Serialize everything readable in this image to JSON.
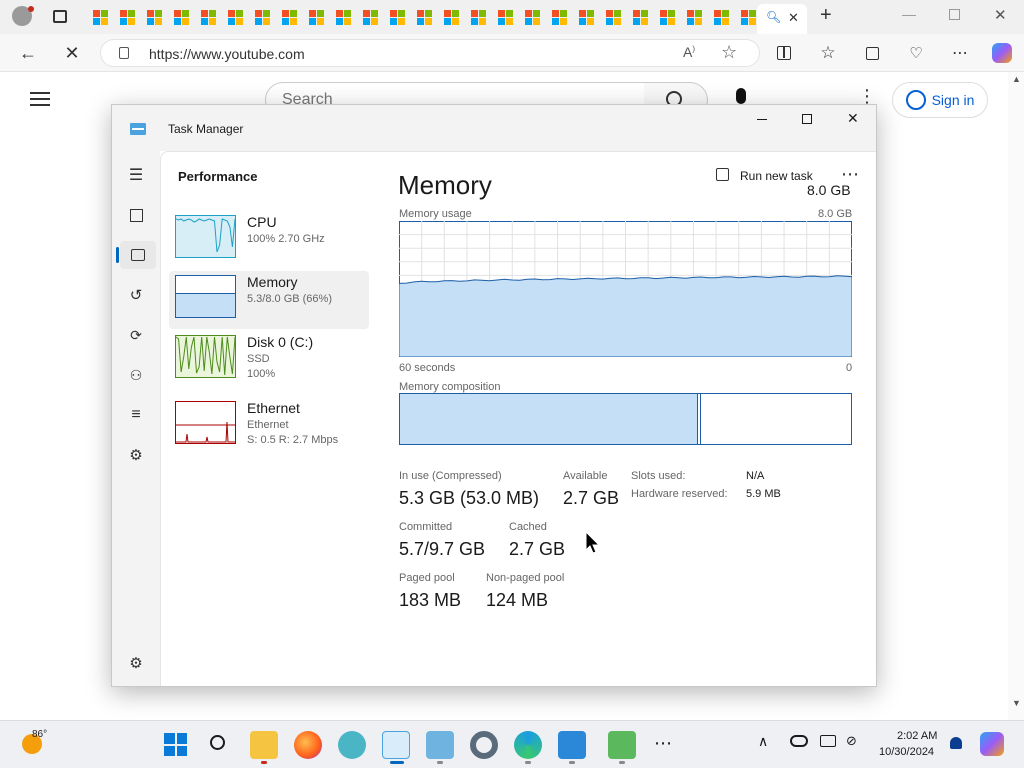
{
  "browser": {
    "url": "https://www.youtube.com",
    "tab_count_label": "",
    "window_controls": [
      "minimize",
      "restore",
      "close"
    ]
  },
  "youtube": {
    "search_placeholder": "Search",
    "signin_label": "Sign in"
  },
  "task_manager": {
    "title": "Task Manager",
    "header": "Performance",
    "run_new_task": "Run new task",
    "resources": [
      {
        "name": "CPU",
        "line1": "100%  2.70 GHz",
        "line2": ""
      },
      {
        "name": "Memory",
        "line1": "5.3/8.0 GB (66%)",
        "line2": ""
      },
      {
        "name": "Disk 0 (C:)",
        "line1": "SSD",
        "line2": "100%"
      },
      {
        "name": "Ethernet",
        "line1": "Ethernet",
        "line2": "S: 0.5  R: 2.7 Mbps"
      }
    ],
    "detail": {
      "title": "Memory",
      "capacity": "8.0 GB",
      "usage_label": "Memory usage",
      "usage_max": "8.0 GB",
      "time_left": "60 seconds",
      "time_right": "0",
      "composition_label": "Memory composition",
      "composition_in_use_fraction": 0.66,
      "stats": {
        "in_use_label": "In use (Compressed)",
        "in_use_value": "5.3 GB (53.0 MB)",
        "available_label": "Available",
        "available_value": "2.7 GB",
        "committed_label": "Committed",
        "committed_value": "5.7/9.7 GB",
        "cached_label": "Cached",
        "cached_value": "2.7 GB",
        "paged_label": "Paged pool",
        "paged_value": "183 MB",
        "nonpaged_label": "Non-paged pool",
        "nonpaged_value": "124 MB",
        "slots_label": "Slots used:",
        "slots_value": "N/A",
        "hw_label": "Hardware reserved:",
        "hw_value": "5.9 MB"
      }
    }
  },
  "taskbar": {
    "weather_temp": "86°",
    "time": "2:02 AM",
    "date": "10/30/2024"
  },
  "colors": {
    "memory_fill": "#c4dff6",
    "memory_stroke": "#1c5ea7",
    "cpu_stroke": "#1aa1c8",
    "disk_stroke": "#4d8c1a",
    "eth_stroke": "#a80000",
    "accent": "#0067c0"
  }
}
